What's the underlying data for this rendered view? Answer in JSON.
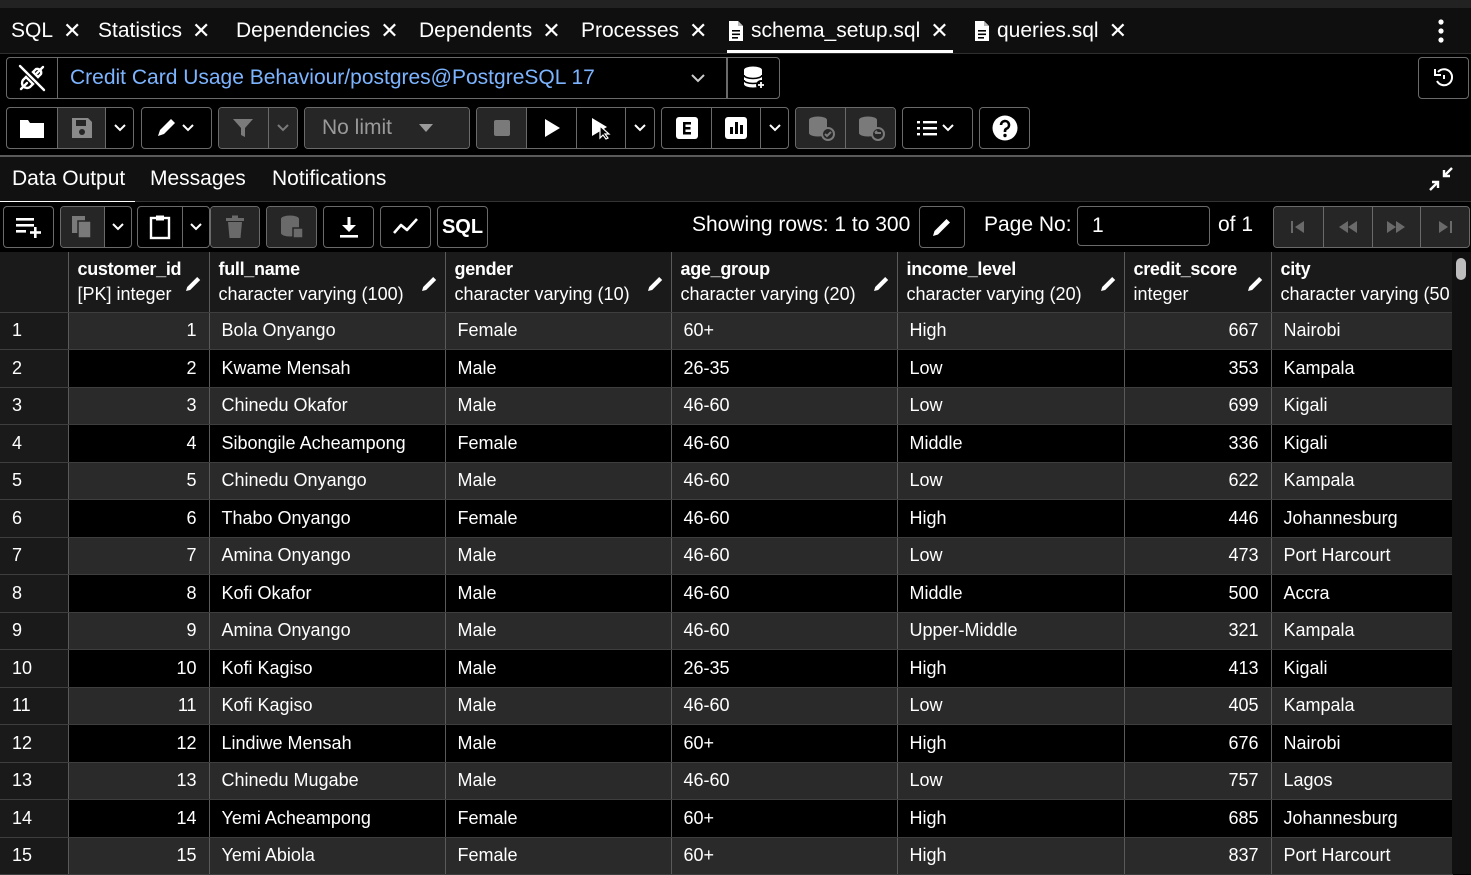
{
  "tabs": [
    {
      "label": "SQL",
      "file": false
    },
    {
      "label": "Statistics",
      "file": false
    },
    {
      "label": "Dependencies",
      "file": false
    },
    {
      "label": "Dependents",
      "file": false
    },
    {
      "label": "Processes",
      "file": false
    },
    {
      "label": "schema_setup.sql",
      "file": true,
      "active": true
    },
    {
      "label": "queries.sql",
      "file": true
    }
  ],
  "connection": {
    "label": "Credit Card Usage Behaviour/postgres@PostgreSQL 17"
  },
  "toolbar": {
    "limit_label": "No limit"
  },
  "result_tabs": [
    "Data Output",
    "Messages",
    "Notifications"
  ],
  "grid_toolbar": {
    "sql_label": "SQL",
    "rows_info": "Showing rows: 1 to 300",
    "page_label": "Page No:",
    "page_value": "1",
    "of_label": "of 1"
  },
  "columns": [
    {
      "name": "customer_id",
      "type": "[PK] integer"
    },
    {
      "name": "full_name",
      "type": "character varying (100)"
    },
    {
      "name": "gender",
      "type": "character varying (10)"
    },
    {
      "name": "age_group",
      "type": "character varying (20)"
    },
    {
      "name": "income_level",
      "type": "character varying (20)"
    },
    {
      "name": "credit_score",
      "type": "integer"
    },
    {
      "name": "city",
      "type": "character varying (50"
    }
  ],
  "rows": [
    [
      "1",
      "1",
      "Bola Onyango",
      "Female",
      "60+",
      "High",
      "667",
      "Nairobi"
    ],
    [
      "2",
      "2",
      "Kwame Mensah",
      "Male",
      "26-35",
      "Low",
      "353",
      "Kampala"
    ],
    [
      "3",
      "3",
      "Chinedu Okafor",
      "Male",
      "46-60",
      "Low",
      "699",
      "Kigali"
    ],
    [
      "4",
      "4",
      "Sibongile Acheampong",
      "Female",
      "46-60",
      "Middle",
      "336",
      "Kigali"
    ],
    [
      "5",
      "5",
      "Chinedu Onyango",
      "Male",
      "46-60",
      "Low",
      "622",
      "Kampala"
    ],
    [
      "6",
      "6",
      "Thabo Onyango",
      "Female",
      "46-60",
      "High",
      "446",
      "Johannesburg"
    ],
    [
      "7",
      "7",
      "Amina Onyango",
      "Male",
      "46-60",
      "Low",
      "473",
      "Port Harcourt"
    ],
    [
      "8",
      "8",
      "Kofi Okafor",
      "Male",
      "46-60",
      "Middle",
      "500",
      "Accra"
    ],
    [
      "9",
      "9",
      "Amina Onyango",
      "Male",
      "46-60",
      "Upper-Middle",
      "321",
      "Kampala"
    ],
    [
      "10",
      "10",
      "Kofi Kagiso",
      "Male",
      "26-35",
      "High",
      "413",
      "Kigali"
    ],
    [
      "11",
      "11",
      "Kofi Kagiso",
      "Male",
      "46-60",
      "Low",
      "405",
      "Kampala"
    ],
    [
      "12",
      "12",
      "Lindiwe Mensah",
      "Male",
      "60+",
      "High",
      "676",
      "Nairobi"
    ],
    [
      "13",
      "13",
      "Chinedu Mugabe",
      "Male",
      "46-60",
      "Low",
      "757",
      "Lagos"
    ],
    [
      "14",
      "14",
      "Yemi Acheampong",
      "Female",
      "60+",
      "High",
      "685",
      "Johannesburg"
    ],
    [
      "15",
      "15",
      "Yemi Abiola",
      "Female",
      "60+",
      "High",
      "837",
      "Port Harcourt"
    ]
  ]
}
